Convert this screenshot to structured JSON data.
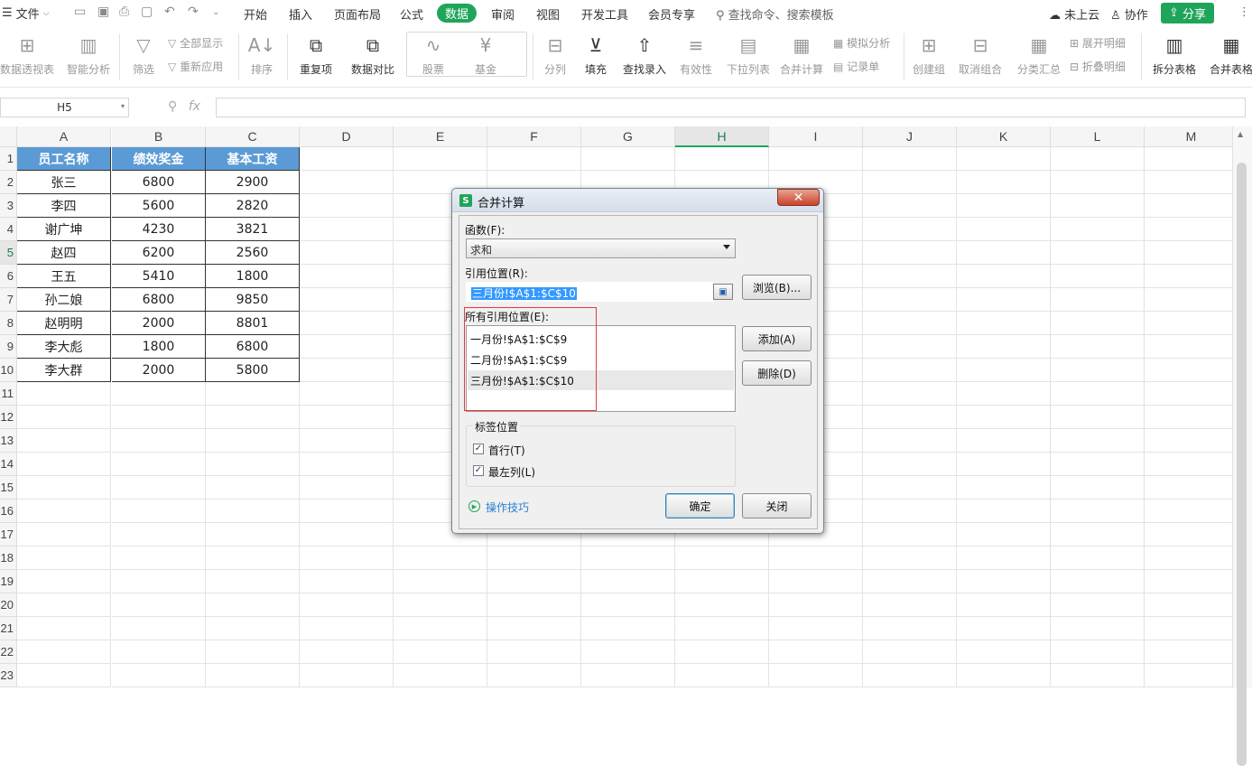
{
  "menubar": {
    "file_label": "文件",
    "tabs": [
      "开始",
      "插入",
      "页面布局",
      "公式",
      "数据",
      "审阅",
      "视图",
      "开发工具",
      "会员专享"
    ],
    "active_tab": "数据",
    "search_label": "查找命令、搜索模板",
    "cloud_label": "未上云",
    "collab_label": "协作",
    "share_label": "分享"
  },
  "ribbon": {
    "pivot": "数据透视表",
    "smart_analysis": "智能分析",
    "filter": "筛选",
    "show_all": "全部显示",
    "reapply": "重新应用",
    "sort": "排序",
    "duplicates": "重复项",
    "compare": "数据对比",
    "stock": "股票",
    "fund": "基金",
    "split_col": "分列",
    "fill": "填充",
    "find_entry": "查找录入",
    "validity": "有效性",
    "dropdown_list": "下拉列表",
    "consolidate": "合并计算",
    "simulate": "模拟分析",
    "record_form": "记录单",
    "create_group": "创建组",
    "ungroup": "取消组合",
    "subtotal": "分类汇总",
    "expand_detail": "展开明细",
    "collapse_detail": "折叠明细",
    "split_table": "拆分表格",
    "merge_table": "合并表格"
  },
  "formula_bar": {
    "name_box": "H5",
    "fx": "fx",
    "formula": ""
  },
  "sheet": {
    "columns": [
      "A",
      "B",
      "C",
      "D",
      "E",
      "F",
      "G",
      "H",
      "I",
      "J",
      "K",
      "L",
      "M"
    ],
    "selected_column": "H",
    "selected_row": 5,
    "rows": [
      1,
      2,
      3,
      4,
      5,
      6,
      7,
      8,
      9,
      10,
      11,
      12,
      13,
      14,
      15,
      16,
      17,
      18,
      19,
      20,
      21,
      22,
      23
    ],
    "header": [
      "员工名称",
      "绩效奖金",
      "基本工资"
    ],
    "data": [
      [
        "张三",
        "6800",
        "2900"
      ],
      [
        "李四",
        "5600",
        "2820"
      ],
      [
        "谢广坤",
        "4230",
        "3821"
      ],
      [
        "赵四",
        "6200",
        "2560"
      ],
      [
        "王五",
        "5410",
        "1800"
      ],
      [
        "孙二娘",
        "6800",
        "9850"
      ],
      [
        "赵明明",
        "2000",
        "8801"
      ],
      [
        "李大彪",
        "1800",
        "6800"
      ],
      [
        "李大群",
        "2000",
        "5800"
      ]
    ]
  },
  "dialog": {
    "title": "合并计算",
    "function_label": "函数(F):",
    "function_value": "求和",
    "reference_label": "引用位置(R):",
    "reference_value": "三月份!$A$1:$C$10",
    "browse_button": "浏览(B)...",
    "all_refs_label": "所有引用位置(E):",
    "all_refs": [
      "一月份!$A$1:$C$9",
      "二月份!$A$1:$C$9",
      "三月份!$A$1:$C$10"
    ],
    "selected_ref_index": 2,
    "add_button": "添加(A)",
    "delete_button": "删除(D)",
    "label_position": "标签位置",
    "first_row": "首行(T)",
    "first_row_checked": true,
    "left_column": "最左列(L)",
    "left_column_checked": true,
    "tips": "操作技巧",
    "ok_button": "确定",
    "close_button": "关闭",
    "highlight_color": "#e23b3b"
  }
}
